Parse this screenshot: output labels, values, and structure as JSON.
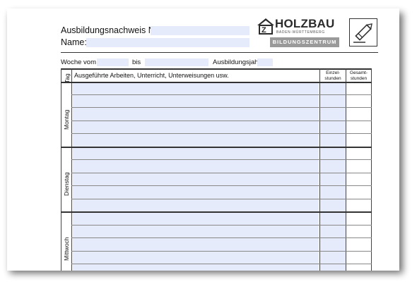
{
  "header": {
    "record_number_label": "Ausbildungsnachweis Nr.",
    "name_label": "Name:",
    "week_from_label": "Woche vom",
    "week_to_label": "bis",
    "training_year_label": "Ausbildungsjahr"
  },
  "logo": {
    "name": "HOLZBAU",
    "region": "BADEN-WÜRTTEMBERG",
    "center": "BILDUNGSZENTRUM",
    "icon": "pencil-icon"
  },
  "table": {
    "day_col": "Tag",
    "work_col": "Ausgeführte Arbeiten, Unterricht, Unterweisungen usw.",
    "single_hours_col": [
      "Einzel-",
      "stunden"
    ],
    "total_hours_col": [
      "Gesamt-",
      "stunden"
    ],
    "days": [
      "Montag",
      "Dienstag",
      "Mittwoch"
    ]
  },
  "colors": {
    "field_fill": "#e6ebfb",
    "logo_bar": "#9a9a9a"
  }
}
